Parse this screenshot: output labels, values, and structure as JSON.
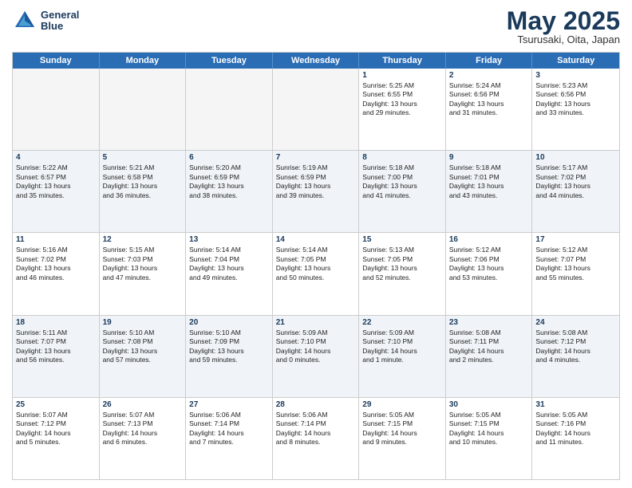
{
  "header": {
    "logo_line1": "General",
    "logo_line2": "Blue",
    "month": "May 2025",
    "location": "Tsurusaki, Oita, Japan"
  },
  "days_of_week": [
    "Sunday",
    "Monday",
    "Tuesday",
    "Wednesday",
    "Thursday",
    "Friday",
    "Saturday"
  ],
  "weeks": [
    [
      {
        "day": "",
        "text": "",
        "empty": true
      },
      {
        "day": "",
        "text": "",
        "empty": true
      },
      {
        "day": "",
        "text": "",
        "empty": true
      },
      {
        "day": "",
        "text": "",
        "empty": true
      },
      {
        "day": "1",
        "text": "Sunrise: 5:25 AM\nSunset: 6:55 PM\nDaylight: 13 hours\nand 29 minutes."
      },
      {
        "day": "2",
        "text": "Sunrise: 5:24 AM\nSunset: 6:56 PM\nDaylight: 13 hours\nand 31 minutes."
      },
      {
        "day": "3",
        "text": "Sunrise: 5:23 AM\nSunset: 6:56 PM\nDaylight: 13 hours\nand 33 minutes."
      }
    ],
    [
      {
        "day": "4",
        "text": "Sunrise: 5:22 AM\nSunset: 6:57 PM\nDaylight: 13 hours\nand 35 minutes."
      },
      {
        "day": "5",
        "text": "Sunrise: 5:21 AM\nSunset: 6:58 PM\nDaylight: 13 hours\nand 36 minutes."
      },
      {
        "day": "6",
        "text": "Sunrise: 5:20 AM\nSunset: 6:59 PM\nDaylight: 13 hours\nand 38 minutes."
      },
      {
        "day": "7",
        "text": "Sunrise: 5:19 AM\nSunset: 6:59 PM\nDaylight: 13 hours\nand 39 minutes."
      },
      {
        "day": "8",
        "text": "Sunrise: 5:18 AM\nSunset: 7:00 PM\nDaylight: 13 hours\nand 41 minutes."
      },
      {
        "day": "9",
        "text": "Sunrise: 5:18 AM\nSunset: 7:01 PM\nDaylight: 13 hours\nand 43 minutes."
      },
      {
        "day": "10",
        "text": "Sunrise: 5:17 AM\nSunset: 7:02 PM\nDaylight: 13 hours\nand 44 minutes."
      }
    ],
    [
      {
        "day": "11",
        "text": "Sunrise: 5:16 AM\nSunset: 7:02 PM\nDaylight: 13 hours\nand 46 minutes."
      },
      {
        "day": "12",
        "text": "Sunrise: 5:15 AM\nSunset: 7:03 PM\nDaylight: 13 hours\nand 47 minutes."
      },
      {
        "day": "13",
        "text": "Sunrise: 5:14 AM\nSunset: 7:04 PM\nDaylight: 13 hours\nand 49 minutes."
      },
      {
        "day": "14",
        "text": "Sunrise: 5:14 AM\nSunset: 7:05 PM\nDaylight: 13 hours\nand 50 minutes."
      },
      {
        "day": "15",
        "text": "Sunrise: 5:13 AM\nSunset: 7:05 PM\nDaylight: 13 hours\nand 52 minutes."
      },
      {
        "day": "16",
        "text": "Sunrise: 5:12 AM\nSunset: 7:06 PM\nDaylight: 13 hours\nand 53 minutes."
      },
      {
        "day": "17",
        "text": "Sunrise: 5:12 AM\nSunset: 7:07 PM\nDaylight: 13 hours\nand 55 minutes."
      }
    ],
    [
      {
        "day": "18",
        "text": "Sunrise: 5:11 AM\nSunset: 7:07 PM\nDaylight: 13 hours\nand 56 minutes."
      },
      {
        "day": "19",
        "text": "Sunrise: 5:10 AM\nSunset: 7:08 PM\nDaylight: 13 hours\nand 57 minutes."
      },
      {
        "day": "20",
        "text": "Sunrise: 5:10 AM\nSunset: 7:09 PM\nDaylight: 13 hours\nand 59 minutes."
      },
      {
        "day": "21",
        "text": "Sunrise: 5:09 AM\nSunset: 7:10 PM\nDaylight: 14 hours\nand 0 minutes."
      },
      {
        "day": "22",
        "text": "Sunrise: 5:09 AM\nSunset: 7:10 PM\nDaylight: 14 hours\nand 1 minute."
      },
      {
        "day": "23",
        "text": "Sunrise: 5:08 AM\nSunset: 7:11 PM\nDaylight: 14 hours\nand 2 minutes."
      },
      {
        "day": "24",
        "text": "Sunrise: 5:08 AM\nSunset: 7:12 PM\nDaylight: 14 hours\nand 4 minutes."
      }
    ],
    [
      {
        "day": "25",
        "text": "Sunrise: 5:07 AM\nSunset: 7:12 PM\nDaylight: 14 hours\nand 5 minutes."
      },
      {
        "day": "26",
        "text": "Sunrise: 5:07 AM\nSunset: 7:13 PM\nDaylight: 14 hours\nand 6 minutes."
      },
      {
        "day": "27",
        "text": "Sunrise: 5:06 AM\nSunset: 7:14 PM\nDaylight: 14 hours\nand 7 minutes."
      },
      {
        "day": "28",
        "text": "Sunrise: 5:06 AM\nSunset: 7:14 PM\nDaylight: 14 hours\nand 8 minutes."
      },
      {
        "day": "29",
        "text": "Sunrise: 5:05 AM\nSunset: 7:15 PM\nDaylight: 14 hours\nand 9 minutes."
      },
      {
        "day": "30",
        "text": "Sunrise: 5:05 AM\nSunset: 7:15 PM\nDaylight: 14 hours\nand 10 minutes."
      },
      {
        "day": "31",
        "text": "Sunrise: 5:05 AM\nSunset: 7:16 PM\nDaylight: 14 hours\nand 11 minutes."
      }
    ]
  ]
}
